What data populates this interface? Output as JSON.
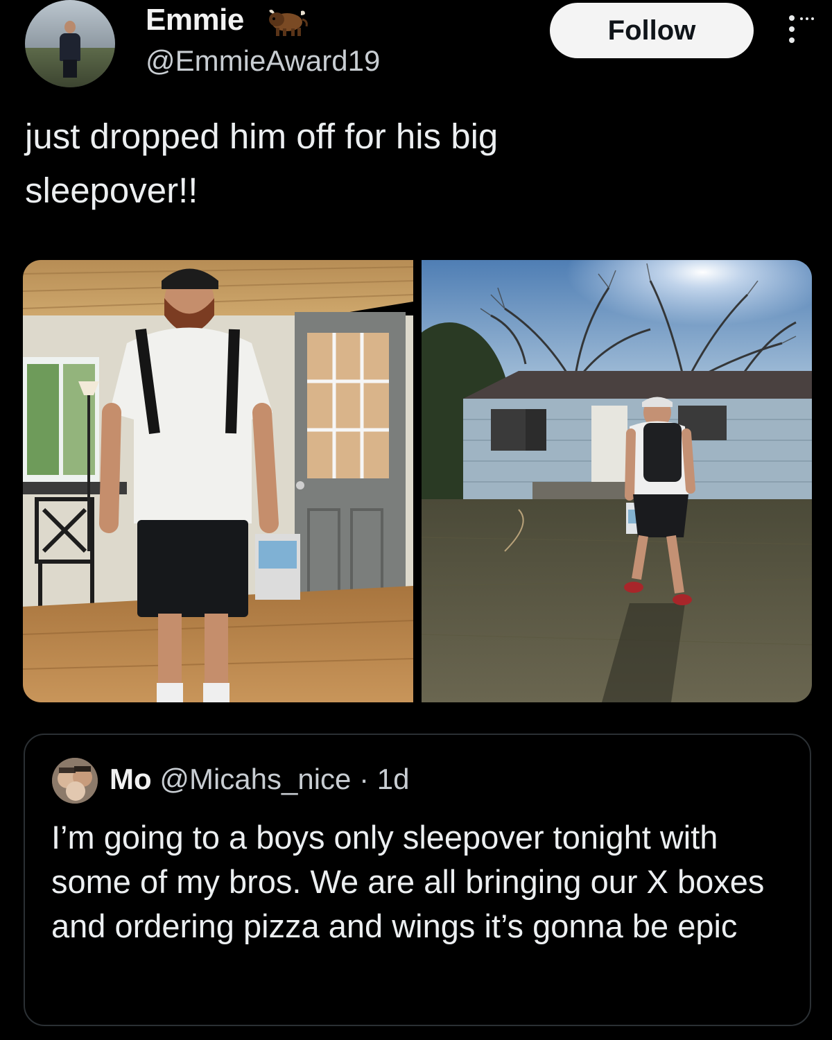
{
  "author": {
    "display_name": "Emmie",
    "handle": "@EmmieAward19",
    "badge_icon": "bison-emoji-icon",
    "avatar_icon": "profile-photo"
  },
  "actions": {
    "follow_label": "Follow",
    "more_icon": "more-options-icon"
  },
  "tweet": {
    "text": "just dropped him off for his big\nsleepover!!",
    "media": [
      {
        "name": "photo-man-indoors"
      },
      {
        "name": "photo-man-walking-to-house"
      }
    ]
  },
  "quoted_tweet": {
    "display_name": "Mo",
    "handle": "@Micahs_nice",
    "separator": "·",
    "time": "1d",
    "text": "I’m going to a boys only sleepover tonight with some of my bros. We are all bringing our X boxes and ordering pizza and wings it’s gonna be epic"
  },
  "colors": {
    "background": "#000000",
    "text": "#e7e9ea",
    "secondary_text": "#c8cdd2",
    "follow_bg": "#f4f4f4",
    "card_border": "#2b3034"
  }
}
